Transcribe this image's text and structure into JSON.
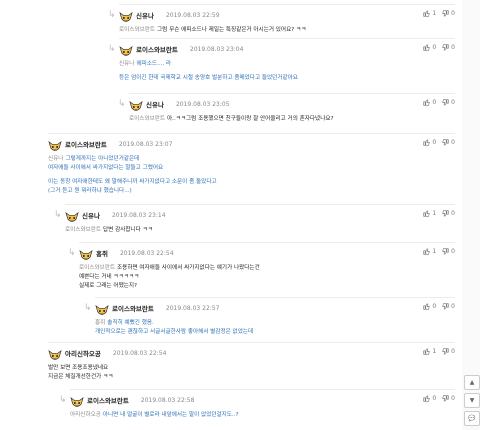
{
  "comments": [
    {
      "author": "신유나",
      "date": "2019.08.03 22:59",
      "up": "1",
      "down": "0",
      "mention": "로이스와브란트",
      "lines": [
        "그럼 무슨 에피소드나 제일는 특징같은거 아시는거 있어요? ㅋㅋ"
      ],
      "blue": false
    },
    {
      "author": "로이스와브란트",
      "date": "2019.08.03 23:04",
      "up": "0",
      "down": "0",
      "mention": "신유나",
      "lines": [
        "에피소드.... 라",
        "",
        "등은 엄이긴 한데 국제학교 시절 송양호 벌분하고 좀메었다고 들었던거같아요"
      ],
      "blue": true
    },
    {
      "author": "신유나",
      "date": "2019.08.03 23:05",
      "up": "0",
      "down": "0",
      "mention": "로이스와브란트",
      "lines": [
        "아..ㅋㅋ그럼 조용했으면 친구들이랑 잘 안어울리고 거의 혼자다녔나요?"
      ],
      "blue": false
    },
    {
      "author": "로이스와브란트",
      "date": "2019.08.03 23:07",
      "up": "0",
      "down": "0",
      "mention": "신유나",
      "lines": [
        "그렇게까지는 아니었던거같은데",
        "여자애들 사이에서 싸가지없다는 말들고 그랬어요",
        "",
        "이는 동창 여자애한테도 왜 말해주니까 싸가지없다고 소문이 좀 돌았다고",
        "(그거 듣고 뭔 뭐라하냐 했습니다...)"
      ],
      "blue": true
    },
    {
      "author": "신유나",
      "date": "2019.08.03 23:14",
      "up": "1",
      "down": "0",
      "mention": "로이스와브란트",
      "lines": [
        "답변 감사합니다 ㅋㅋ"
      ],
      "blue": false
    },
    {
      "author": "홍쥐",
      "date": "2019.08.03 22:54",
      "up": "1",
      "down": "0",
      "mention": "로이스와브란트",
      "lines": [
        "조용하면 여자애들 사이에서 싸가지없다는 얘기가 나왔다는건",
        "예쁜다는 거네 ㅋㅋㅋㅋㅋ",
        "실제로 그래는 어땠는지?"
      ],
      "blue": false
    },
    {
      "author": "로이스와브란트",
      "date": "2019.08.03 22:57",
      "up": "0",
      "down": "0",
      "mention": "홍쥐",
      "lines": [
        "솔직히 예뻤긴 했음.",
        "개인적으로는 괜찮하고 서글서글한사람 좋아해서 별감정은 없었는데"
      ],
      "blue": true
    },
    {
      "author": "아리신하오공",
      "date": "2019.08.03 22:54",
      "up": "1",
      "down": "0",
      "mention": "",
      "lines": [
        "벌만 보면 조용조용냈네요",
        "지금은 체질개선한건가 ㅋㅋ"
      ],
      "blue": false
    },
    {
      "author": "로이스와브란트",
      "date": "2019.08.03 22:58",
      "up": "0",
      "down": "0",
      "mention": "아리신하오공",
      "lines": [
        "아니면 내 얼굴이 별로라 내앞에서는 말이 없었던걸지도..?"
      ],
      "blue": true
    }
  ],
  "scroll": {
    "up_label": "▲",
    "down_label": "▼",
    "reply_label": "💬"
  }
}
